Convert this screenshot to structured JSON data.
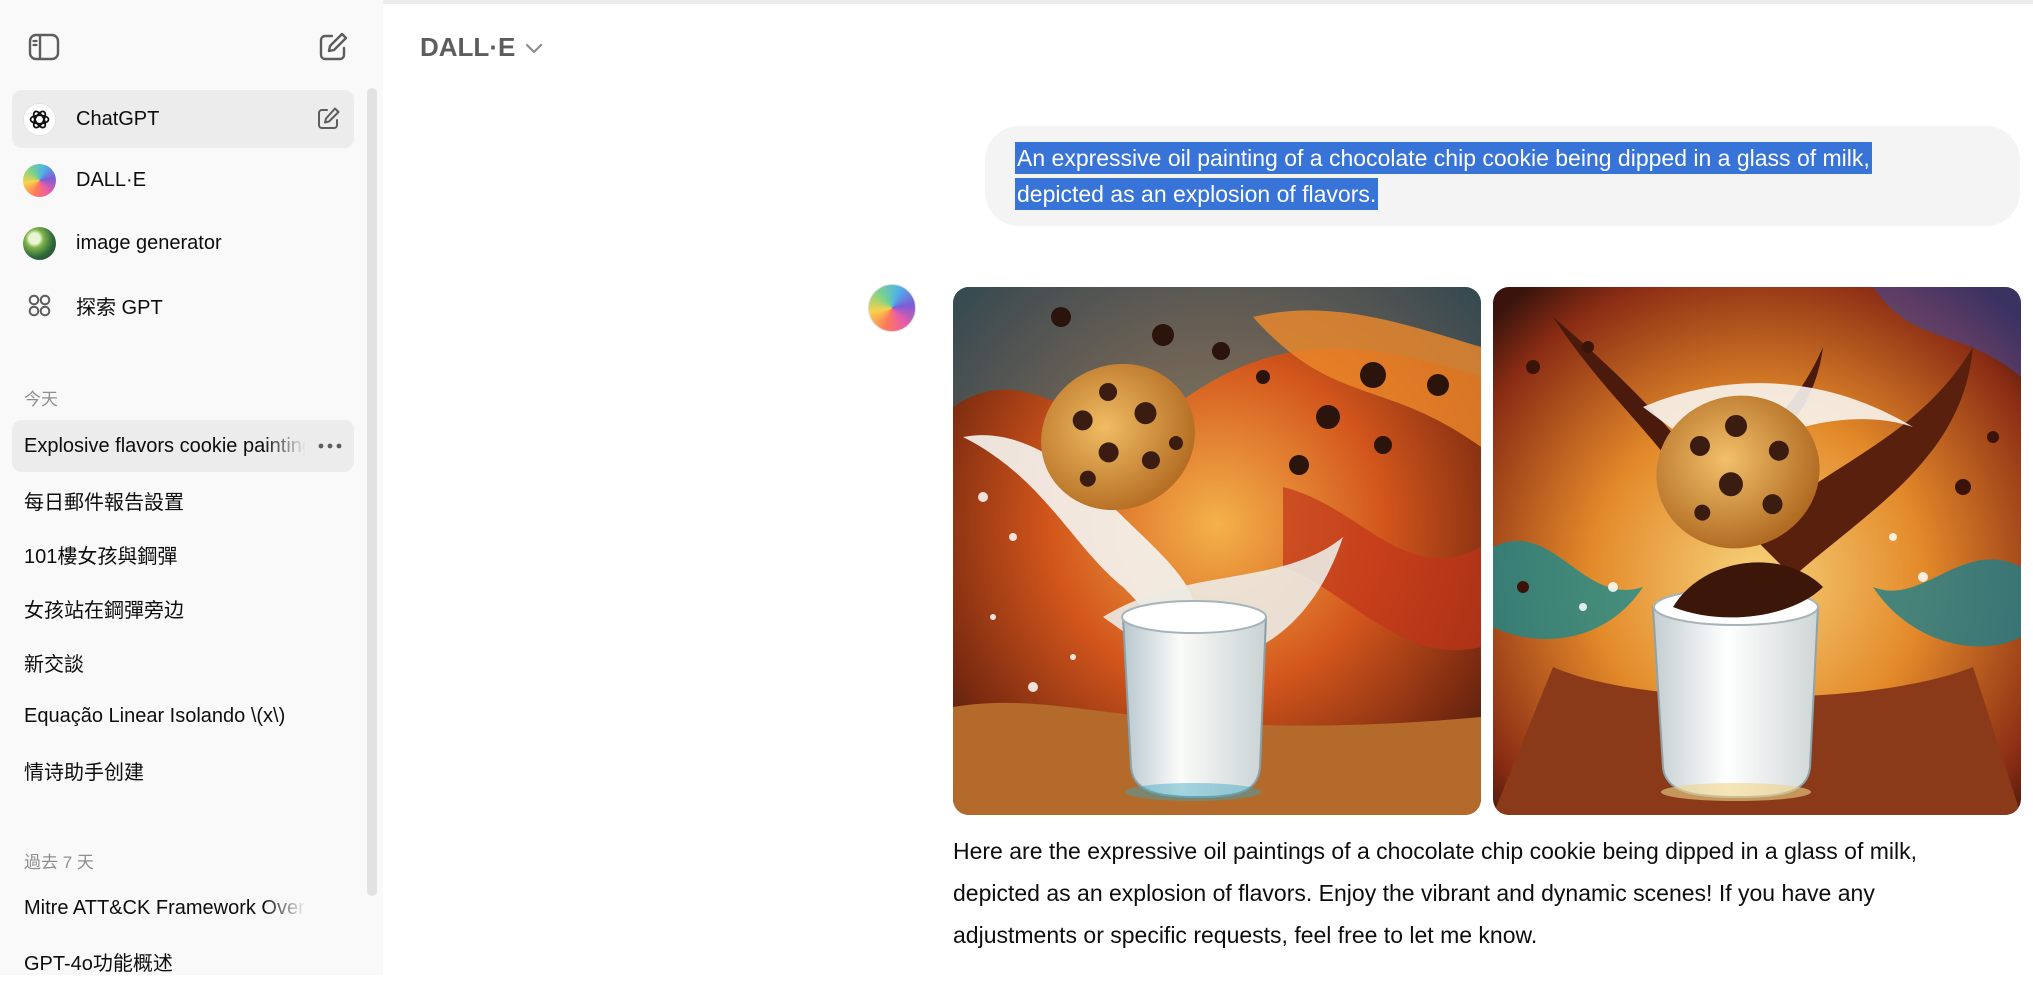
{
  "sidebar": {
    "toggle_icon": "sidebar-toggle-icon",
    "new_chat_icon": "new-chat-icon",
    "gpts": [
      {
        "label": "ChatGPT",
        "icon": "openai-logo-icon"
      },
      {
        "label": "DALL·E",
        "icon": "dalle-avatar-icon"
      },
      {
        "label": "image generator",
        "icon": "image-generator-avatar-icon"
      },
      {
        "label": "探索 GPT",
        "icon": "explore-grid-icon"
      }
    ],
    "sections": [
      {
        "label": "今天",
        "items": [
          {
            "label": "Explosive flavors cookie painting"
          },
          {
            "label": "每日郵件報告設置"
          },
          {
            "label": "101樓女孩與鋼彈"
          },
          {
            "label": "女孩站在鋼彈旁边"
          },
          {
            "label": "新交談"
          },
          {
            "label": "Equação Linear Isolando \\(x\\)"
          },
          {
            "label": "情诗助手创建"
          }
        ]
      },
      {
        "label": "過去 7 天",
        "items": [
          {
            "label": "Mitre ATT&CK Framework Overview"
          },
          {
            "label": "GPT-4o功能概述"
          }
        ]
      }
    ]
  },
  "header": {
    "model_name": "DALL·E",
    "dropdown_icon": "chevron-down-icon"
  },
  "conversation": {
    "user_message": {
      "line1": "An expressive oil painting of a chocolate chip cookie being dipped in a glass of milk,",
      "line2": "depicted as an explosion of flavors."
    },
    "assistant": {
      "images": [
        {
          "alt": "Oil painting of a chocolate chip cookie splashing into a glass of milk, variant 1"
        },
        {
          "alt": "Oil painting of a chocolate chip cookie splashing into a glass of milk, variant 2"
        }
      ],
      "response": "Here are the expressive oil paintings of a chocolate chip cookie being dipped in a glass of milk, depicted as an explosion of flavors. Enjoy the vibrant and dynamic scenes! If you have any adjustments or specific requests, feel free to let me know."
    }
  },
  "colors": {
    "sidebar_bg": "#f9f9f9",
    "active_item_bg": "#ececec",
    "selection_highlight": "#3874d8",
    "bubble_bg": "#f4f4f4"
  }
}
